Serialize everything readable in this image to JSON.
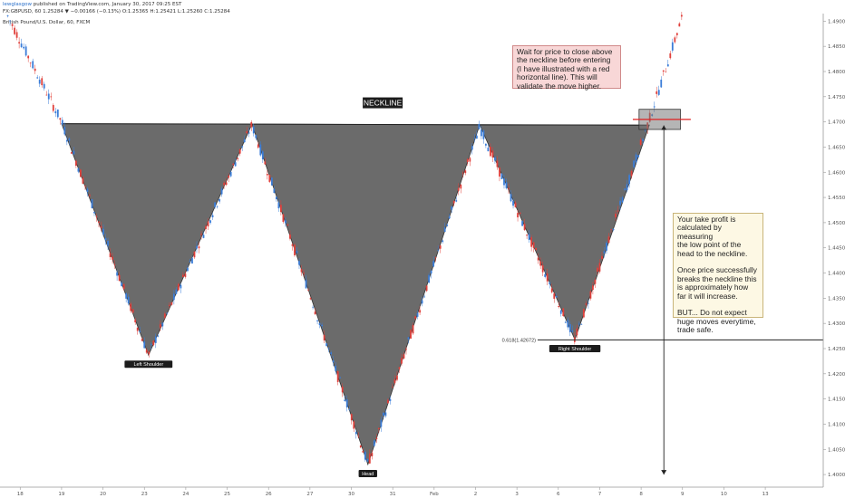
{
  "header": {
    "publisher_user": "lewglasgow",
    "publisher_text": " published on TradingView.com, January 30, 2017 09:25 EST",
    "ohlc_line": "FX:GBPUSD, 60  1.25284 ▼ −0.00166 (−0.13%)  O:1.25365  H:1.25421  L:1.25260  C:1.25284",
    "subtitle": "British Pound/U.S. Dollar, 60, FXCM"
  },
  "notes": {
    "entry": "Wait for price to close above\nthe neckline before entering\n(I have illustrated with a red\nhorizontal line). This will\nvalidate the move higher.",
    "take_profit": "Your take profit is\ncalculated by measuring\nthe low point of the\nhead to the neckline.\n\nOnce price successfully\nbreaks the neckline this\nis approximately how\nfar it will increase.\n\nBUT... Do not expect\nhuge moves everytime,\ntrade safe."
  },
  "colors": {
    "triangle_fill": "#6b6b6b",
    "up_candle": "#3b7dd8",
    "down_candle": "#e0403b",
    "entry_line": "#e02020",
    "label_bg": "#1c1c1c",
    "note_red_bg": "#f8d7d7",
    "note_cream_bg": "#fdf8e4"
  },
  "chart_data": {
    "type": "line",
    "title": "British Pound/U.S. Dollar, 60, FXCM",
    "symbol": "FX:GBPUSD",
    "pattern": "inverse head and shoulders",
    "y_axis": {
      "position": "right",
      "ticks": [
        "1.49000",
        "1.48500",
        "1.48000",
        "1.47500",
        "1.47000",
        "1.46500",
        "1.46000",
        "1.45500",
        "1.45000",
        "1.44500",
        "1.44000",
        "1.43500",
        "1.43000",
        "1.42500",
        "1.42000",
        "1.41500",
        "1.41000",
        "1.40500",
        "1.40000"
      ],
      "range": [
        1.3975,
        1.4915
      ]
    },
    "x_axis": {
      "ticks": [
        "18",
        "19",
        "20",
        "23",
        "24",
        "25",
        "26",
        "27",
        "30",
        "31",
        "Feb",
        "2",
        "3",
        "6",
        "7",
        "8",
        "9",
        "10",
        "13"
      ],
      "range": [
        -0.4,
        19.4
      ]
    },
    "price_path": {
      "x": [
        -0.3,
        1.0,
        3.1,
        5.6,
        8.4,
        11.1,
        13.4,
        15.2,
        16.0
      ],
      "y": [
        1.491,
        1.47,
        1.4237,
        1.4694,
        1.402,
        1.469,
        1.4268,
        1.4705,
        1.491
      ]
    },
    "neckline": {
      "x": [
        1.0,
        15.2
      ],
      "y": [
        1.46965,
        1.46935
      ],
      "label": "NECKLINE"
    },
    "shoulders": [
      {
        "label": "Left Shoulder",
        "x": 3.1,
        "y": 1.4237
      },
      {
        "label": "Head",
        "x": 8.4,
        "y": 1.402
      },
      {
        "label": "Right Shoulder",
        "x": 13.4,
        "y": 1.4268
      }
    ],
    "fib_level": {
      "label": "0.618(1.42672)",
      "value": 1.42672,
      "x_start": 12.5
    },
    "entry_line": {
      "value": 1.4705,
      "x": [
        14.8,
        16.2
      ]
    },
    "entry_box": {
      "x": [
        14.95,
        15.95
      ],
      "y": [
        1.4685,
        1.4725
      ]
    },
    "take_profit_arrow": {
      "x": 15.55,
      "y_start": 1.4693,
      "y_end": 1.4
    }
  }
}
